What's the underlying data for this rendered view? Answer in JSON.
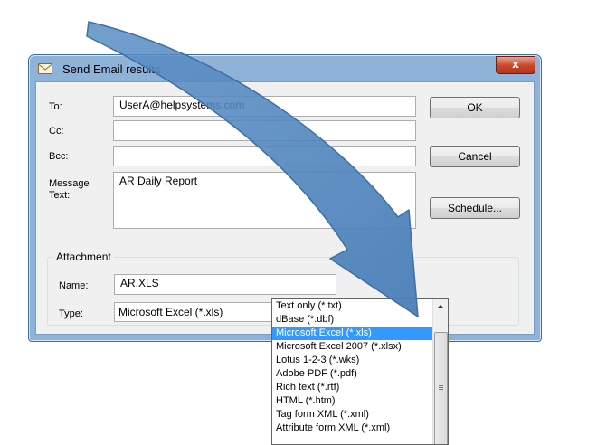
{
  "window": {
    "title": "Send Email results",
    "close_label": "x"
  },
  "form": {
    "to_label": "To:",
    "to_value": "UserA@helpsystems.com",
    "cc_label": "Cc:",
    "cc_value": "",
    "bcc_label": "Bcc:",
    "bcc_value": "",
    "message_label_line1": "Message",
    "message_label_line2": "Text:",
    "message_value": "AR Daily Report"
  },
  "buttons": {
    "ok": "OK",
    "cancel": "Cancel",
    "schedule": "Schedule..."
  },
  "attachment": {
    "group_title": "Attachment",
    "name_label": "Name:",
    "name_value": "AR.XLS",
    "type_label": "Type:",
    "type_value": "Microsoft Excel  (*.xls)"
  },
  "dropdown": {
    "options": [
      "Text only  (*.txt)",
      "dBase  (*.dbf)",
      "Microsoft Excel  (*.xls)",
      "Microsoft Excel 2007  (*.xlsx)",
      "Lotus 1-2-3  (*.wks)",
      "Adobe PDF (*.pdf)",
      "Rich text (*.rtf)",
      "HTML  (*.htm)",
      "Tag form XML  (*.xml)",
      "Attribute form XML  (*.xml)"
    ],
    "selected_index": 2
  },
  "colors": {
    "window_frame": "#8fb3d8",
    "selection": "#3399ff",
    "arrow": "#5b8ec4"
  }
}
